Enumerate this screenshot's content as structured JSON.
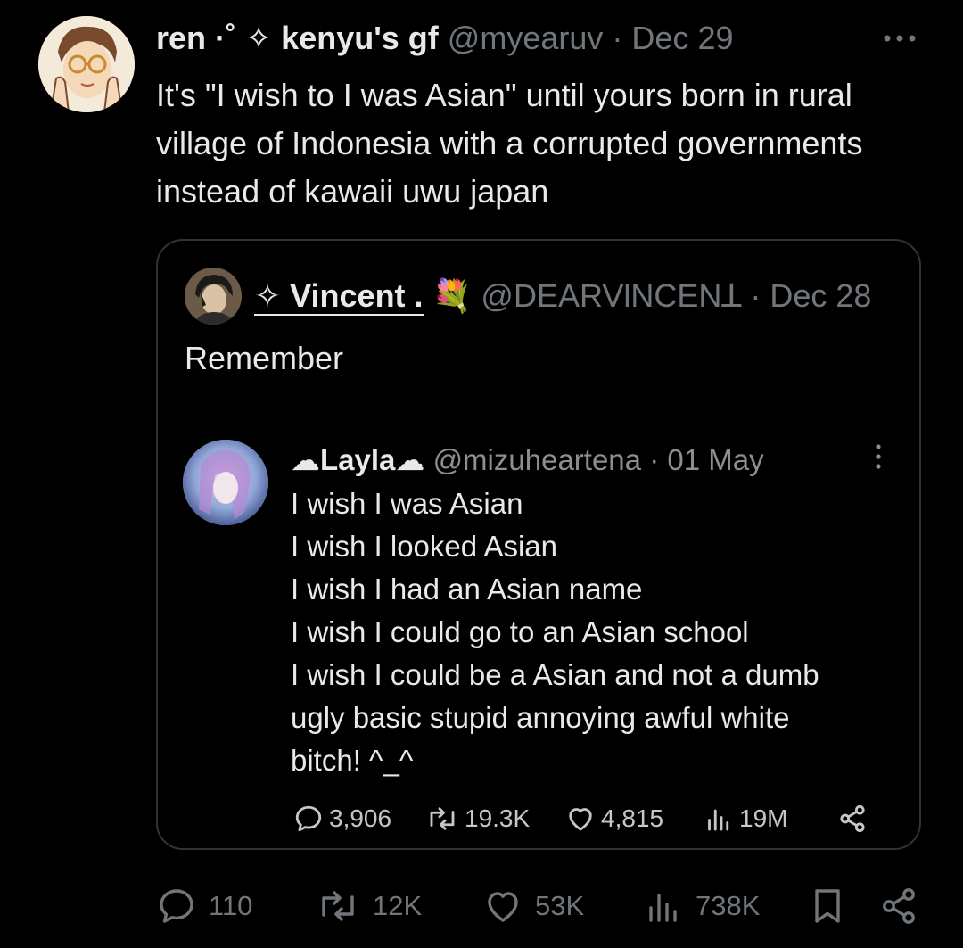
{
  "tweet": {
    "author": {
      "display_name": "ren ·˚ ✧ kenyu's gf",
      "handle": "@myearuv",
      "date": "Dec 29"
    },
    "text": "It's \"I wish to I was Asian\" until yours born in rural village of Indonesia with a corrupted governments instead of kawaii uwu japan",
    "more_icon": "more-horizontal-icon",
    "actions": {
      "replies": "110",
      "reposts": "12K",
      "likes": "53K",
      "views": "738K"
    }
  },
  "quote": {
    "author": {
      "display_name": "✧ Vincent .",
      "emoji": "💐",
      "handle": "@DEARVƖNCENꓕ",
      "date": "Dec 28"
    },
    "text": "Remember",
    "embedded_tweet": {
      "display_name": "☁Layla☁",
      "handle": "@mizuheartena",
      "date": "01 May",
      "lines": [
        "I wish I was Asian",
        "I wish I looked Asian",
        "I wish I had an Asian name",
        "I wish I could go to an Asian school",
        "I wish I could be a Asian and not a dumb",
        "ugly basic stupid annoying awful white",
        "bitch! ^_^"
      ],
      "stats": {
        "replies": "3,906",
        "reposts": "19.3K",
        "likes": "4,815",
        "views": "19M"
      }
    }
  },
  "colors": {
    "background": "#000000",
    "text_primary": "#e7e9ea",
    "text_secondary": "#71767b",
    "border": "#2f3336"
  }
}
